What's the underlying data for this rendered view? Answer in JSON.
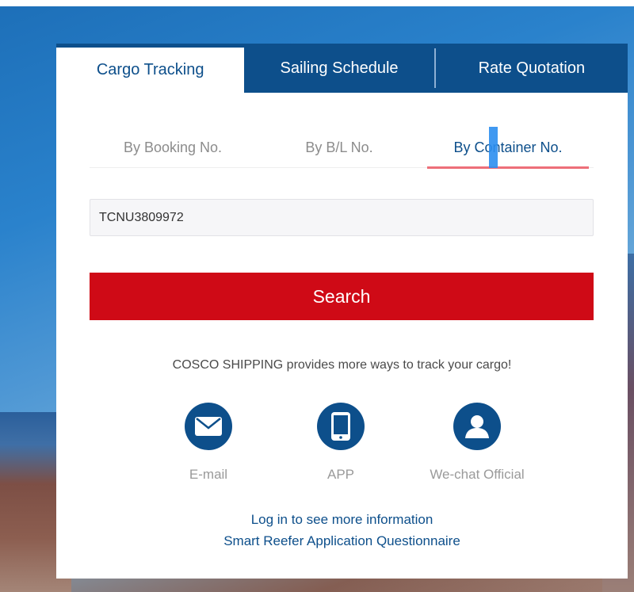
{
  "main_tabs": [
    {
      "label": "Cargo Tracking",
      "active": true
    },
    {
      "label": "Sailing Schedule",
      "active": false
    },
    {
      "label": "Rate Quotation",
      "active": false
    }
  ],
  "sub_tabs": [
    {
      "label": "By Booking No.",
      "active": false
    },
    {
      "label": "By B/L No.",
      "active": false
    },
    {
      "label": "By Container No.",
      "active": true
    }
  ],
  "search_input": {
    "value": "TCNU3809972"
  },
  "search_button": {
    "label": "Search"
  },
  "note": "COSCO SHIPPING provides more ways to track your cargo!",
  "ways": [
    {
      "label": "E-mail",
      "icon": "email-icon"
    },
    {
      "label": "APP",
      "icon": "phone-icon"
    },
    {
      "label": "We-chat Official",
      "icon": "user-icon"
    }
  ],
  "links": {
    "login": "Log in to see more information",
    "reefer": "Smart Reefer Application Questionnaire"
  },
  "colors": {
    "brand_blue": "#0d4f8b",
    "search_red": "#cf0a16",
    "active_underline": "#ed6f79"
  }
}
